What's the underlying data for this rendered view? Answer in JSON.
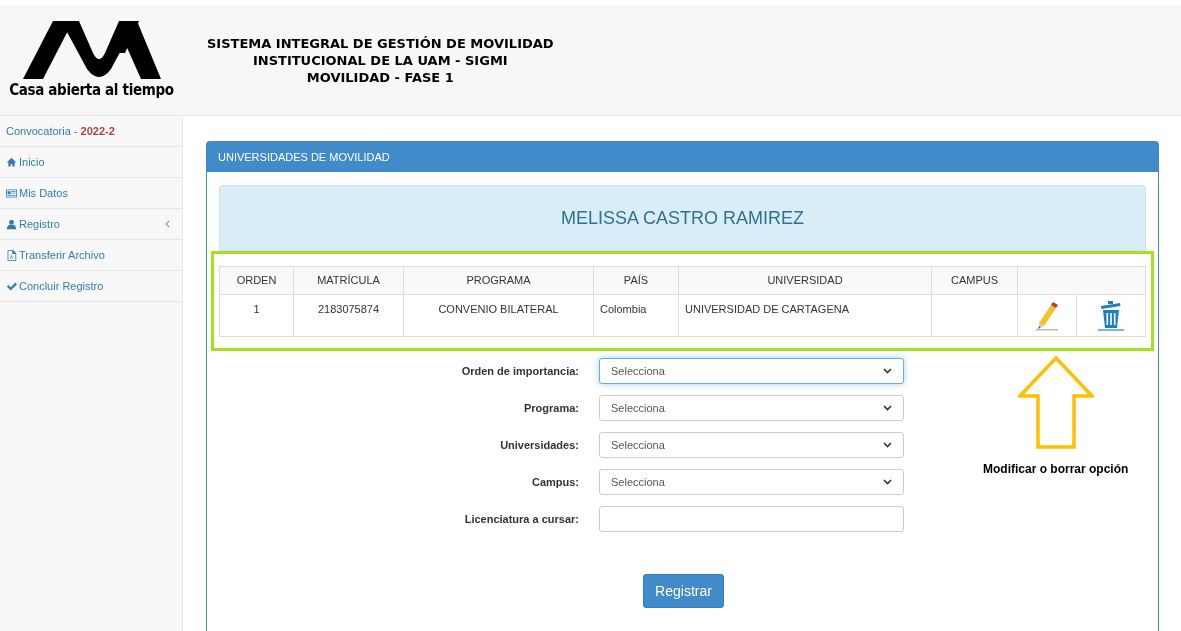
{
  "header": {
    "logo_caption": "Casa abierta al tiempo",
    "title_lines": [
      "SISTEMA INTEGRAL DE GESTIÓN DE MOVILIDAD",
      "INSTITUCIONAL DE LA UAM - SIGMI",
      "MOVILIDAD - FASE 1"
    ]
  },
  "sidebar": {
    "items": [
      {
        "kind": "heading",
        "label": "Convocatoria - **2022-2**"
      },
      {
        "kind": "link",
        "label": "Inicio"
      },
      {
        "kind": "link",
        "label": "Mis Datos"
      },
      {
        "kind": "link",
        "label": "Registro",
        "expanded": false
      },
      {
        "kind": "link",
        "label": "Transferir Archivo"
      },
      {
        "kind": "link",
        "label": "Concluir Registro"
      }
    ]
  },
  "panel": {
    "title": "UNIVERSIDADES DE MOVILIDAD",
    "student_name": "MELISSA CASTRO RAMIREZ",
    "table": {
      "columns": [
        "ORDEN",
        "MATRÍCULA",
        "PROGRAMA",
        "PAÍS",
        "UNIVERSIDAD",
        "CAMPUS"
      ],
      "rows": [
        {
          "cells": [
            "1",
            "2183075874",
            "CONVENIO BILATERAL",
            "Colombia",
            "UNIVERSIDAD DE CARTAGENA",
            ""
          ]
        }
      ]
    },
    "form": {
      "fields": [
        {
          "kind": "select",
          "label": "Orden de importancia:",
          "value": "Selecciona",
          "focused": true
        },
        {
          "kind": "select",
          "label": "Programa:",
          "value": "Selecciona",
          "focused": false
        },
        {
          "kind": "select",
          "label": "Universidades:",
          "value": "Selecciona",
          "focused": false
        },
        {
          "kind": "select",
          "label": "Campus:",
          "value": "Selecciona",
          "focused": false
        },
        {
          "kind": "text",
          "label": "Licenciatura a cursar:",
          "focused": false
        }
      ]
    },
    "submit": "Registrar"
  },
  "annotation": {
    "text": "Modificar o borrar opción"
  }
}
